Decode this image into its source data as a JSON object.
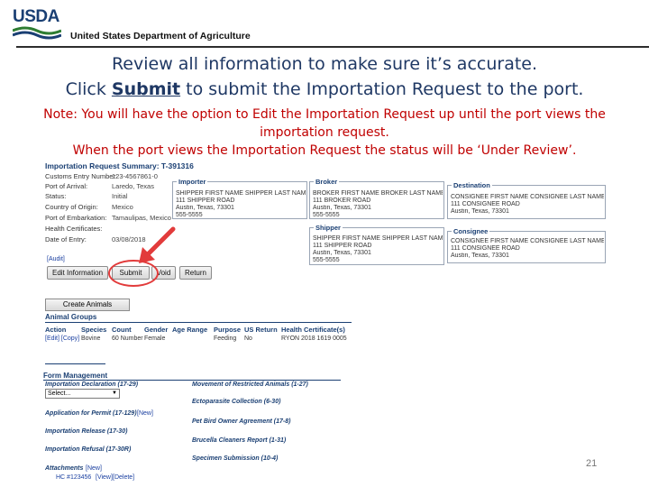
{
  "header": {
    "logo_text": "USDA",
    "department": "United States Department of Agriculture"
  },
  "slide": {
    "line1": "Review all information to make sure it’s accurate.",
    "line2_pre": "Click ",
    "line2_bold": "Submit",
    "line2_post": " to submit the Importation Request to the port.",
    "note1": "Note: You will have the option to Edit the Importation Request up until the port views the",
    "note1b": "importation request.",
    "note2": "When the port views the Importation Request the status will be ‘Under Review’.",
    "page_number": "21"
  },
  "summary": {
    "title": "Importation Request Summary: T-391316",
    "rows": [
      {
        "label": "Customs Entry Number:",
        "value": "123-4567861-0"
      },
      {
        "label": "Port of Arrival:",
        "value": "Laredo, Texas"
      },
      {
        "label": "Status:",
        "value": "Initial"
      },
      {
        "label": "Country of Origin:",
        "value": "Mexico"
      },
      {
        "label": "Port of Embarkation:",
        "value": "Tamaulipas, Mexico"
      },
      {
        "label": "Health Certificates:",
        "value": ""
      },
      {
        "label": "Date of Entry:",
        "value": "03/08/2018"
      }
    ],
    "importer": {
      "legend": "Importer",
      "lines": [
        "SHIPPER FIRST NAME SHIPPER LAST NAME",
        "111 SHIPPER ROAD",
        "Austin, Texas, 73301",
        "555-5555"
      ]
    },
    "broker": {
      "legend": "Broker",
      "lines": [
        "BROKER FIRST NAME BROKER LAST NAME",
        "111 BROKER ROAD",
        "Austin, Texas, 73301",
        "555-5555"
      ]
    },
    "destination": {
      "legend": "Destination",
      "lines": [
        "CONSIGNEE FIRST NAME CONSIGNEE LAST NAME",
        "111 CONSIGNEE ROAD",
        "Austin, Texas, 73301"
      ]
    },
    "shipper": {
      "legend": "Shipper",
      "lines": [
        "SHIPPER FIRST NAME SHIPPER LAST NAME",
        "111 SHIPPER ROAD",
        "Austin, Texas, 73301",
        "555-5555"
      ]
    },
    "consignee": {
      "legend": "Consignee",
      "lines": [
        "CONSIGNEE FIRST NAME CONSIGNEE LAST NAME",
        "111 CONSIGNEE ROAD",
        "Austin, Texas, 73301"
      ]
    },
    "audit_link": "[Audit]",
    "buttons": {
      "edit": "Edit Information",
      "submit": "Submit",
      "void": "Void",
      "return": "Return"
    }
  },
  "animals": {
    "create_button": "Create Animals",
    "section_title": "Animal Groups",
    "headers": [
      "Action",
      "Species",
      "Count",
      "Gender",
      "Age Range",
      "Purpose",
      "US Return",
      "Health Certificate(s)"
    ],
    "row": {
      "action": "[Edit] [Copy]",
      "species": "Bovine",
      "count": "60 Number",
      "gender": "Female",
      "age_range": "",
      "purpose": "Feeding",
      "us_return": "No",
      "health_cert": "RYON 2018 1619 0005"
    }
  },
  "forms": {
    "section_title": "Form Management",
    "importation_declaration": "Importation Declaration (17-29)",
    "select_value": "Select...",
    "application_permit": "Application for Permit (17-129)",
    "new_link": "[New]",
    "importation_release": "Importation Release (17-30)",
    "importation_refusal": "Importation Refusal (17-30R)",
    "attachments": "Attachments",
    "attachment_file": "HC #123456",
    "view_link": "[View]",
    "delete_link": "[Delete]",
    "movement_restricted": "Movement of Restricted Animals (1-27)",
    "ectoparasite": "Ectoparasite Collection (6-30)",
    "pet_bird": "Pet Bird Owner Agreement (17-8)",
    "brucella": "Brucella Cleaners Report (1-31)",
    "specimen": "Specimen Submission (10-4)"
  },
  "colors": {
    "headline": "#1f3864",
    "note": "#c00000",
    "highlight": "#e23b3b",
    "brand": "#1a3f73"
  }
}
